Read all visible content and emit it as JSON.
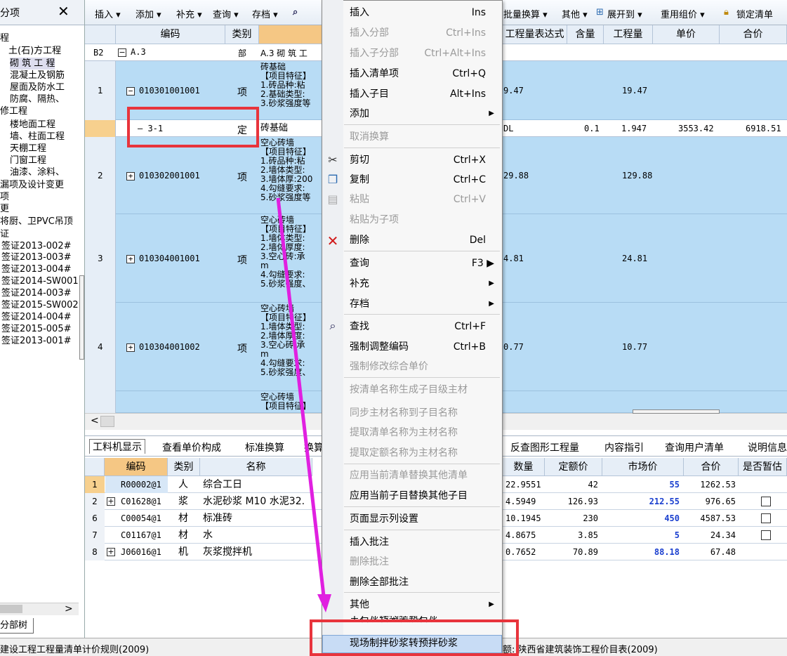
{
  "left": {
    "title": "分项",
    "close": "✕",
    "tree": [
      "程",
      "土(石)方工程",
      "砌 筑 工 程",
      "混凝土及钢筋",
      "屋面及防水工",
      "防腐、隔热、",
      "修工程",
      "楼地面工程",
      "墙、柱面工程",
      "天棚工程",
      "门窗工程",
      "油漆、涂料、",
      "漏项及设计变更",
      "项",
      "更",
      "将厨、卫PVC吊顶",
      "证",
      "签证2013-002#",
      "签证2013-003#",
      "签证2013-004#",
      "签证2014-SW001",
      "签证2014-003#",
      "签证2015-SW002",
      "签证2014-004#",
      "签证2015-005#",
      "签证2013-001#"
    ],
    "tab": "分部树",
    "scroll_arrow": ">"
  },
  "toolbar": {
    "items": [
      "插入 ▾",
      "添加 ▾",
      "补充 ▾",
      "查询 ▾",
      "存档 ▾",
      "批量换算 ▾",
      "其他 ▾",
      "展开到 ▾",
      "重用组价 ▾",
      "锁定清单"
    ]
  },
  "grid": {
    "headers": {
      "code": "编码",
      "category": "类别",
      "expr": "工程量表达式",
      "qty_rate": "含量",
      "quantity": "工程量",
      "unit_price": "单价",
      "total": "合价"
    },
    "b2": {
      "num": "B2",
      "code": "A.3",
      "category": "部",
      "name": "A.3 砌 筑 工"
    },
    "rows": [
      {
        "num": "1",
        "code": "010301001001",
        "category": "项",
        "desc": [
          "砖基础",
          "【项目特征】",
          "1.砖品种:粘",
          "2.基础类型:",
          "3.砂浆强度等"
        ],
        "expr": "9.47",
        "quantity": "19.47"
      },
      {
        "num": "",
        "code": "3-1",
        "category": "定",
        "desc": [
          "砖基础"
        ],
        "expr": "DL",
        "qty_rate": "0.1",
        "quantity": "1.947",
        "unit_price": "3553.42",
        "total": "6918.51"
      },
      {
        "num": "2",
        "code": "010302001001",
        "category": "项",
        "desc": [
          "空心砖墙",
          "【项目特征】",
          "1.砖品种:粘",
          "2.墙体类型:",
          "3.墙体厚:200",
          "4.勾缝要求:",
          "5.砂浆强度等"
        ],
        "expr": "29.88",
        "quantity": "129.88"
      },
      {
        "num": "3",
        "code": "010304001001",
        "category": "项",
        "desc": [
          "空心砖墙",
          "【项目特征】",
          "1.墙体类型:",
          "2.墙体厚度:",
          "3.空心砖:承",
          "m",
          "4.勾缝要求:",
          "5.砂浆强度、"
        ],
        "expr": "4.81",
        "quantity": "24.81"
      },
      {
        "num": "4",
        "code": "010304001002",
        "category": "项",
        "desc": [
          "空心砖墙",
          "【项目特征】",
          "1.墙体类型:",
          "2.墙体厚度:",
          "3.空心砖:承",
          "m",
          "4.勾缝要求:",
          "5.砂浆强度、"
        ],
        "expr": "0.77",
        "quantity": "10.77"
      },
      {
        "num": "",
        "code": "",
        "category": "",
        "desc": [
          "空心砖墙",
          "【项目特征】"
        ],
        "expr": "",
        "quantity": ""
      }
    ],
    "hscroll_arrow": "<"
  },
  "bottom": {
    "tabs": [
      "工料机显示",
      "查看单价构成",
      "标准换算",
      "换算",
      "反查图形工程量",
      "内容指引",
      "查询用户清单",
      "说明信息"
    ],
    "headers": {
      "code": "编码",
      "category": "类别",
      "name": "名称",
      "qty": "数量",
      "quota_price": "定额价",
      "market_price": "市场价",
      "total": "合价",
      "estimate": "是否暂估"
    },
    "rows": [
      {
        "num": "1",
        "code": "R00002@1",
        "category": "人",
        "name": "综合工日",
        "qty": "22.9551",
        "quota_price": "42",
        "market_price": "55",
        "total": "1262.53",
        "has_check": false,
        "expand": false
      },
      {
        "num": "2",
        "code": "C01628@1",
        "category": "浆",
        "name": "水泥砂浆 M10 水泥32.",
        "qty": "4.5949",
        "quota_price": "126.93",
        "market_price": "212.55",
        "total": "976.65",
        "has_check": true,
        "expand": true
      },
      {
        "num": "6",
        "code": "C00054@1",
        "category": "材",
        "name": "标准砖",
        "qty": "10.1945",
        "quota_price": "230",
        "market_price": "450",
        "total": "4587.53",
        "has_check": true,
        "expand": false
      },
      {
        "num": "7",
        "code": "C01167@1",
        "category": "材",
        "name": "水",
        "qty": "4.8675",
        "quota_price": "3.85",
        "market_price": "5",
        "total": "24.34",
        "has_check": true,
        "expand": false
      },
      {
        "num": "8",
        "code": "J06016@1",
        "category": "机",
        "name": "灰浆搅拌机",
        "qty": "0.7652",
        "quota_price": "70.89",
        "market_price": "88.18",
        "total": "67.48",
        "has_check": false,
        "expand": true
      }
    ]
  },
  "status": {
    "left": "建设工程工程量清单计价规则(2009)",
    "right": "额: 陕西省建筑装饰工程价目表(2009)"
  },
  "menu": {
    "items": [
      {
        "label": "插入",
        "shortcut": "Ins",
        "disabled": false
      },
      {
        "label": "插入分部",
        "shortcut": "Ctrl+Ins",
        "disabled": true
      },
      {
        "label": "插入子分部",
        "shortcut": "Ctrl+Alt+Ins",
        "disabled": true
      },
      {
        "label": "插入清单项",
        "shortcut": "Ctrl+Q",
        "disabled": false
      },
      {
        "label": "插入子目",
        "shortcut": "Alt+Ins",
        "disabled": false
      },
      {
        "label": "添加",
        "shortcut": "▶",
        "disabled": false
      },
      {
        "label": "取消换算",
        "shortcut": "",
        "disabled": true
      },
      {
        "label": "剪切",
        "shortcut": "Ctrl+X",
        "disabled": false
      },
      {
        "label": "复制",
        "shortcut": "Ctrl+C",
        "disabled": false
      },
      {
        "label": "粘贴",
        "shortcut": "Ctrl+V",
        "disabled": true
      },
      {
        "label": "粘贴为子项",
        "shortcut": "",
        "disabled": true
      },
      {
        "label": "删除",
        "shortcut": "Del",
        "disabled": false
      },
      {
        "label": "查询",
        "shortcut": "F3 ▶",
        "disabled": false
      },
      {
        "label": "补充",
        "shortcut": "▶",
        "disabled": false
      },
      {
        "label": "存档",
        "shortcut": "▶",
        "disabled": false
      },
      {
        "label": "查找",
        "shortcut": "Ctrl+F",
        "disabled": false
      },
      {
        "label": "强制调整编码",
        "shortcut": "Ctrl+B",
        "disabled": false
      },
      {
        "label": "强制修改综合单价",
        "shortcut": "",
        "disabled": true
      },
      {
        "label": "按清单名称生成子目级主材",
        "shortcut": "",
        "disabled": true
      },
      {
        "label": "同步主材名称到子目名称",
        "shortcut": "",
        "disabled": true
      },
      {
        "label": "提取清单名称为主材名称",
        "shortcut": "",
        "disabled": true
      },
      {
        "label": "提取定额名称为主材名称",
        "shortcut": "",
        "disabled": true
      },
      {
        "label": "应用当前清单替换其他清单",
        "shortcut": "",
        "disabled": true
      },
      {
        "label": "应用当前子目替换其他子目",
        "shortcut": "",
        "disabled": false
      },
      {
        "label": "页面显示列设置",
        "shortcut": "",
        "disabled": false
      },
      {
        "label": "插入批注",
        "shortcut": "",
        "disabled": false
      },
      {
        "label": "删除批注",
        "shortcut": "",
        "disabled": true
      },
      {
        "label": "删除全部批注",
        "shortcut": "",
        "disabled": false
      },
      {
        "label": "其他",
        "shortcut": "▶",
        "disabled": false
      },
      {
        "label": "主石灰转袋装熟石灰",
        "shortcut": "",
        "disabled": false
      },
      {
        "label": "现场制拌砂浆转预拌砂浆",
        "shortcut": "",
        "disabled": false
      }
    ]
  },
  "colors": {
    "accent_red": "#e8343c",
    "arrow_magenta": "#e020e0",
    "row_blue": "#b8dcf5",
    "header_orange": "#f5c784"
  }
}
